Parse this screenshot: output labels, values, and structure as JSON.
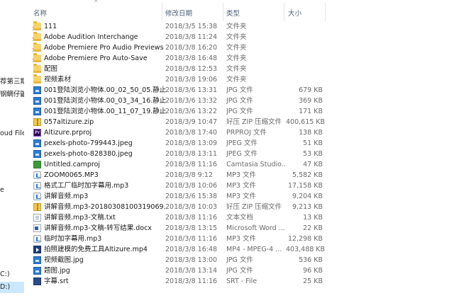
{
  "nav_fragments": [
    {
      "id": "nav-frag-1",
      "text": "荐第三期"
    },
    {
      "id": "nav-frag-2",
      "text": "钢鲷仔鼬"
    },
    {
      "id": "nav-frag-3",
      "text": "oud Files"
    },
    {
      "id": "nav-frag-4",
      "text": "e"
    },
    {
      "id": "nav-frag-5",
      "text": "C:)"
    },
    {
      "id": "nav-frag-6",
      "text": "D:)"
    }
  ],
  "columns": {
    "name": "名称",
    "date": "修改日期",
    "type": "类型",
    "size": "大小"
  },
  "files": [
    {
      "name": "111",
      "date": "2018/3/5 15:38",
      "type": "文件夹",
      "size": "",
      "icon": "folder-icon"
    },
    {
      "name": "Adobe Audition Interchange",
      "date": "2018/3/8 11:24",
      "type": "文件夹",
      "size": "",
      "icon": "folder-icon"
    },
    {
      "name": "Adobe Premiere Pro Audio Previews",
      "date": "2018/3/8 16:20",
      "type": "文件夹",
      "size": "",
      "icon": "folder-icon"
    },
    {
      "name": "Adobe Premiere Pro Auto-Save",
      "date": "2018/3/8 16:48",
      "type": "文件夹",
      "size": "",
      "icon": "folder-icon"
    },
    {
      "name": "配图",
      "date": "2018/3/8 12:53",
      "type": "文件夹",
      "size": "",
      "icon": "folder-icon"
    },
    {
      "name": "视频素材",
      "date": "2018/3/8 19:06",
      "type": "文件夹",
      "size": "",
      "icon": "folder-icon"
    },
    {
      "name": "001登陆浏览小物体.00_02_50_05.静止00...",
      "date": "2018/3/6 13:31",
      "type": "JPG 文件",
      "size": "679 KB",
      "icon": "jpg-icon"
    },
    {
      "name": "001登陆浏览小物体.00_03_34_16.静止00...",
      "date": "2018/3/6 13:32",
      "type": "JPG 文件",
      "size": "369 KB",
      "icon": "jpg-icon"
    },
    {
      "name": "001登陆浏览小物体.00_11_07_19.静止00...",
      "date": "2018/3/6 13:22",
      "type": "JPG 文件",
      "size": "171 KB",
      "icon": "jpg-icon"
    },
    {
      "name": "057altizure.zip",
      "date": "2018/3/9 10:47",
      "type": "好压 ZIP 压缩文件",
      "size": "400,615 KB",
      "icon": "zip-icon"
    },
    {
      "name": "Altizure.prproj",
      "date": "2018/3/8 17:40",
      "type": "PRPROJ 文件",
      "size": "138 KB",
      "icon": "premiere-icon"
    },
    {
      "name": "pexels-photo-799443.jpeg",
      "date": "2018/3/8 13:09",
      "type": "JPEG 文件",
      "size": "51 KB",
      "icon": "jpeg-icon"
    },
    {
      "name": "pexels-photo-828380.jpeg",
      "date": "2018/3/8 13:11",
      "type": "JPEG 文件",
      "size": "53 KB",
      "icon": "jpeg-icon"
    },
    {
      "name": "Untitled.camproj",
      "date": "2018/3/8 11:16",
      "type": "Camtasia Studio...",
      "size": "47 KB",
      "icon": "camtasia-icon"
    },
    {
      "name": "ZOOM0065.MP3",
      "date": "2018/3/8 9:12",
      "type": "MP3 文件",
      "size": "5,582 KB",
      "icon": "audio-icon"
    },
    {
      "name": "格式工厂临时加字幕用.mp3",
      "date": "2018/3/8 10:06",
      "type": "MP3 文件",
      "size": "17,158 KB",
      "icon": "audio-icon"
    },
    {
      "name": "讲解音频.mp3",
      "date": "2018/3/6 15:38",
      "type": "MP3 文件",
      "size": "9,204 KB",
      "icon": "audio-icon"
    },
    {
      "name": "讲解音频.mp3-20180308100319069.z...",
      "date": "2018/3/8 10:03",
      "type": "好压 ZIP 压缩文件",
      "size": "9,213 KB",
      "icon": "zip-icon"
    },
    {
      "name": "讲解音频.mp3-文稿.txt",
      "date": "2018/3/8 11:16",
      "type": "文本文档",
      "size": "13 KB",
      "icon": "text-file-icon"
    },
    {
      "name": "讲解音频.mp3-文稿-转写结果.docx",
      "date": "2018/3/8 13:15",
      "type": "Microsoft Word ...",
      "size": "22 KB",
      "icon": "word-icon"
    },
    {
      "name": "临时加字幕用.mp3",
      "date": "2018/3/8 11:16",
      "type": "MP3 文件",
      "size": "12,298 KB",
      "icon": "audio-icon"
    },
    {
      "name": "拍照建模的免费工具Altizure.mp4",
      "date": "2018/3/8 16:48",
      "type": "MP4 - MPEG-4 ...",
      "size": "403,488 KB",
      "icon": "video-icon"
    },
    {
      "name": "视频截图.jpg",
      "date": "2018/3/8 13:00",
      "type": "JPG 文件",
      "size": "536 KB",
      "icon": "jpg-icon"
    },
    {
      "name": "题图.jpg",
      "date": "2018/3/8 13:14",
      "type": "JPG 文件",
      "size": "96 KB",
      "icon": "jpg-icon"
    },
    {
      "name": "字幕.srt",
      "date": "2018/3/8 11:16",
      "type": "SRT - File",
      "size": "25 KB",
      "icon": "srt-icon"
    }
  ]
}
